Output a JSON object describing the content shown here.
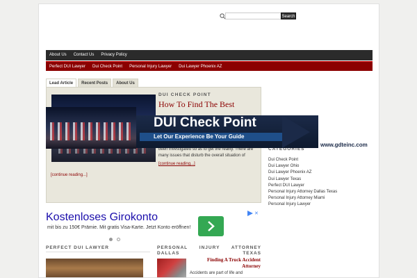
{
  "search": {
    "placeholder": "",
    "button_label": "Search"
  },
  "nav_top": [
    "About Us",
    "Contact Us",
    "Privacy Policy"
  ],
  "nav_red": [
    "Perfect DUI Lawyer",
    "Dui Check Point",
    "Personal Injury Lawyer",
    "Dui Lawyer Phoenix AZ"
  ],
  "tabs": [
    "Lead Article",
    "Recent Posts",
    "About Us"
  ],
  "lead": {
    "kicker": "DUI CHECK POINT",
    "title": "How To Find The Best",
    "excerpt": "been investigated so as to get the reality. There are many issues that disturb the overall situation of",
    "excerpt_link": "[continue reading...]",
    "continue": "[continue reading...]"
  },
  "banner": {
    "title": "DUI Check Point",
    "subtitle": "Let Our Experience Be Your Guide",
    "url": "www.gdteinc.com"
  },
  "sidebar": {
    "heading": "CATEGORIES",
    "items": [
      "Dui Check Point",
      "Dui Lawyer Ohio",
      "Dui Lawyer Phoenix AZ",
      "Dui Lawyer Texas",
      "Perfect DUI Lawyer",
      "Personal Injury Attorney Dallas Texas",
      "Personal Injury Attorney Miami",
      "Personal Injury Lawyer"
    ]
  },
  "ad": {
    "title": "Kostenloses Girokonto",
    "text": "mit bis zu 150€ Prämie. Mit gratis Visa-Karte. Jetzt Konto eröffnen!",
    "close": "✕"
  },
  "bottom": {
    "left_heading": "PERFECT DUI LAWYER",
    "right_heading": "PERSONAL INJURY ATTORNEY DALLAS TEXAS",
    "post_title": "Finding A Truck Accident Attorney",
    "post_text": "Accidents are part of life and"
  },
  "colors": {
    "nav_dark": "#2b2b2b",
    "nav_red": "#8b0000",
    "accent": "#8b0000",
    "banner": "#1b2a48",
    "ad_green": "#34a853"
  }
}
